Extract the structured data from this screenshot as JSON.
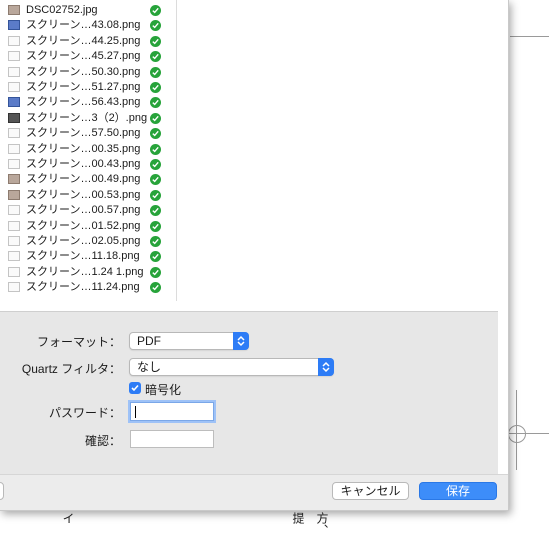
{
  "files": [
    {
      "name": "DSC02752.jpg",
      "icon": "photo-icon",
      "kind": "photo"
    },
    {
      "name": "スクリーン…43.08.png",
      "icon": "screenshot-icon",
      "kind": "blue"
    },
    {
      "name": "スクリーン…44.25.png",
      "icon": "screenshot-icon",
      "kind": "light"
    },
    {
      "name": "スクリーン…45.27.png",
      "icon": "screenshot-icon",
      "kind": "light"
    },
    {
      "name": "スクリーン…50.30.png",
      "icon": "screenshot-icon",
      "kind": "light"
    },
    {
      "name": "スクリーン…51.27.png",
      "icon": "screenshot-icon",
      "kind": "light"
    },
    {
      "name": "スクリーン…56.43.png",
      "icon": "screenshot-icon",
      "kind": "blue"
    },
    {
      "name": "スクリーン…3（2）.png",
      "icon": "screenshot-icon",
      "kind": "dark"
    },
    {
      "name": "スクリーン…57.50.png",
      "icon": "screenshot-icon",
      "kind": "light"
    },
    {
      "name": "スクリーン…00.35.png",
      "icon": "screenshot-icon",
      "kind": "light"
    },
    {
      "name": "スクリーン…00.43.png",
      "icon": "screenshot-icon",
      "kind": "light"
    },
    {
      "name": "スクリーン…00.49.png",
      "icon": "screenshot-icon",
      "kind": "photo"
    },
    {
      "name": "スクリーン…00.53.png",
      "icon": "screenshot-icon",
      "kind": "photo"
    },
    {
      "name": "スクリーン…00.57.png",
      "icon": "screenshot-icon",
      "kind": "light"
    },
    {
      "name": "スクリーン…01.52.png",
      "icon": "screenshot-icon",
      "kind": "light"
    },
    {
      "name": "スクリーン…02.05.png",
      "icon": "screenshot-icon",
      "kind": "light"
    },
    {
      "name": "スクリーン…11.18.png",
      "icon": "screenshot-icon",
      "kind": "light"
    },
    {
      "name": "スクリーン…1.24 1.png",
      "icon": "screenshot-icon",
      "kind": "light"
    },
    {
      "name": "スクリーン…11.24.png",
      "icon": "screenshot-icon",
      "kind": "light"
    }
  ],
  "options": {
    "format_label": "フォーマット：",
    "format_value": "PDF",
    "quartz_label": "Quartz フィルタ：",
    "quartz_value": "なし",
    "encrypt_label": "暗号化",
    "encrypt_checked": true,
    "password_label": "パスワード：",
    "password_value": "",
    "confirm_label": "確認：",
    "confirm_value": ""
  },
  "buttons": {
    "cancel": "キャンセル",
    "save": "保存"
  },
  "background_text": {
    "col_a": "イ",
    "col_b": "提",
    "col_c": "方、"
  },
  "colors": {
    "accent": "#2d7cf6",
    "check": "#27a33a"
  }
}
